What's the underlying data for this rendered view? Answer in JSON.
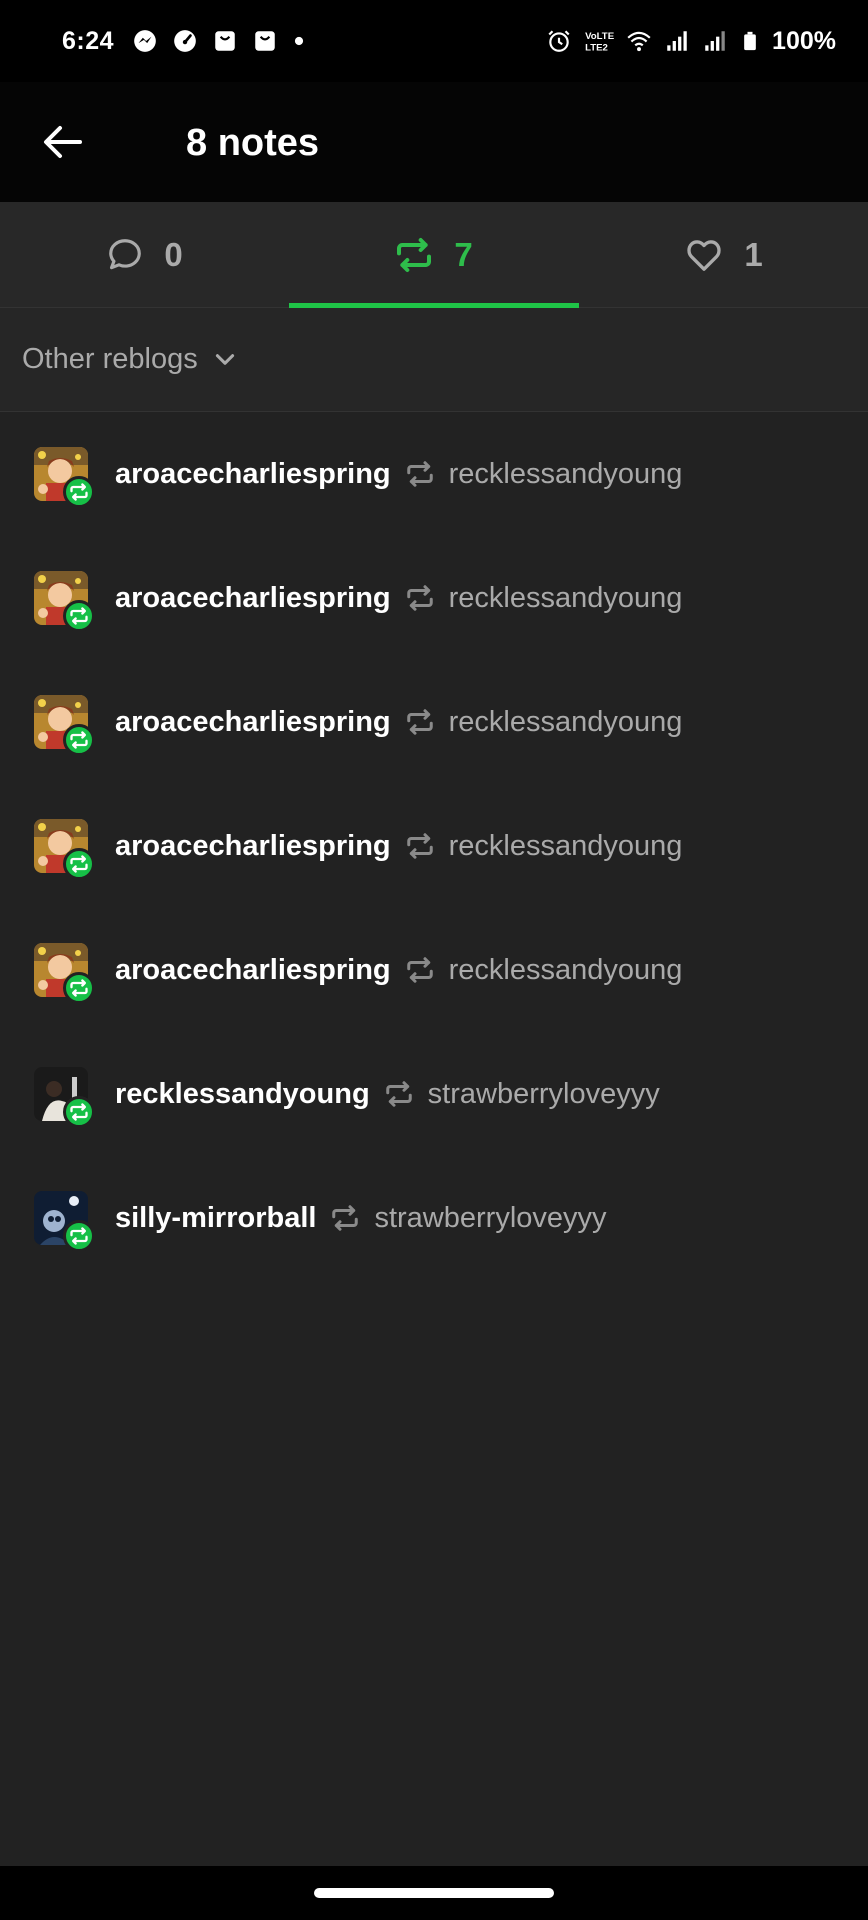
{
  "status_bar": {
    "time": "6:24",
    "battery_percent": "100%",
    "left_icons": [
      "messenger-icon",
      "speedometer-icon",
      "shopping-bag-icon",
      "shopping-bag-icon",
      "dot-icon"
    ],
    "right_icons": [
      "alarm-icon",
      "volte-icon",
      "wifi-icon",
      "signal-icon",
      "signal-icon",
      "battery-icon"
    ]
  },
  "header": {
    "title": "8 notes"
  },
  "tabs": [
    {
      "name": "replies",
      "icon": "comment-icon",
      "count": "0",
      "active": false
    },
    {
      "name": "reblogs",
      "icon": "reblog-icon",
      "count": "7",
      "active": true
    },
    {
      "name": "likes",
      "icon": "heart-icon",
      "count": "1",
      "active": false
    }
  ],
  "filter": {
    "label": "Other reblogs"
  },
  "reblogs": [
    {
      "blog": "aroacecharliespring",
      "from": "recklessandyoung",
      "avatar": "cartoon-avatar"
    },
    {
      "blog": "aroacecharliespring",
      "from": "recklessandyoung",
      "avatar": "cartoon-avatar"
    },
    {
      "blog": "aroacecharliespring",
      "from": "recklessandyoung",
      "avatar": "cartoon-avatar"
    },
    {
      "blog": "aroacecharliespring",
      "from": "recklessandyoung",
      "avatar": "cartoon-avatar"
    },
    {
      "blog": "aroacecharliespring",
      "from": "recklessandyoung",
      "avatar": "cartoon-avatar"
    },
    {
      "blog": "recklessandyoung",
      "from": "strawberryloveyyy",
      "avatar": "dark-photo-avatar"
    },
    {
      "blog": "silly-mirrorball",
      "from": "strawberryloveyyy",
      "avatar": "night-avatar"
    }
  ],
  "colors": {
    "accent_green": "#1fc447",
    "background": "#222222",
    "muted_text": "#aaaaaa"
  }
}
